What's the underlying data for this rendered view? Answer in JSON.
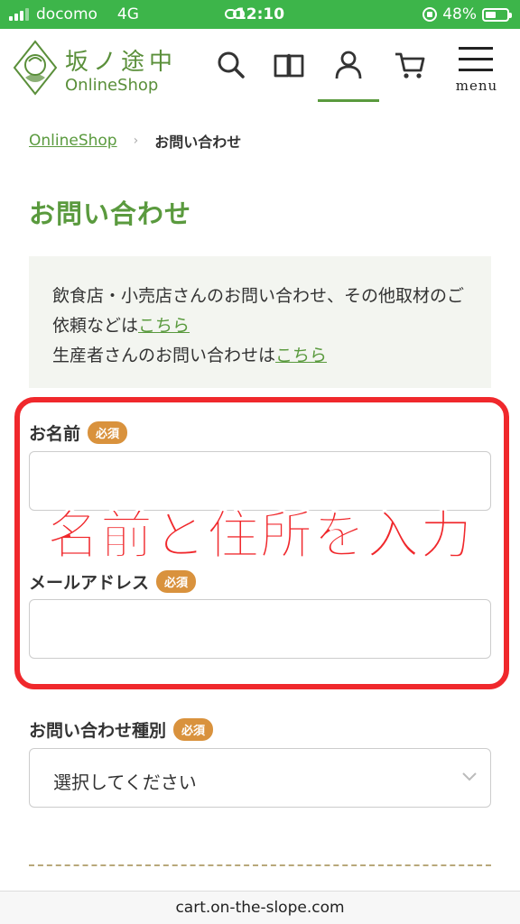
{
  "status_bar": {
    "carrier": "docomo",
    "network": "4G",
    "time": "12:10",
    "battery": "48%",
    "battery_level": 0.48,
    "background_color": "#3db54a"
  },
  "header": {
    "logo_text_jp": "坂ノ途中",
    "logo_text_en": "OnlineShop",
    "icons": [
      "search-icon",
      "book-icon",
      "user-icon",
      "cart-icon"
    ],
    "menu_label": "menu",
    "accent_color": "#5a9a3e"
  },
  "breadcrumb": {
    "home": "OnlineShop",
    "separator": "›",
    "current": "お問い合わせ"
  },
  "page_title": "お問い合わせ",
  "notice": {
    "line1_text": "飲食店・小売店さんのお問い合わせ、その他取材のご依頼などは",
    "line1_link": "こちら",
    "line2_text": "生産者さんのお問い合わせは",
    "line2_link": "こちら"
  },
  "form": {
    "name_label": "お名前",
    "email_label": "メールアドレス",
    "type_label": "お問い合わせ種別",
    "required_badge": "必須",
    "type_placeholder": "選択してください",
    "name_value": "",
    "email_value": ""
  },
  "annotation": {
    "text": "名前と住所を入力",
    "color": "#f0282c"
  },
  "url_bar": {
    "url": "cart.on-the-slope.com"
  }
}
